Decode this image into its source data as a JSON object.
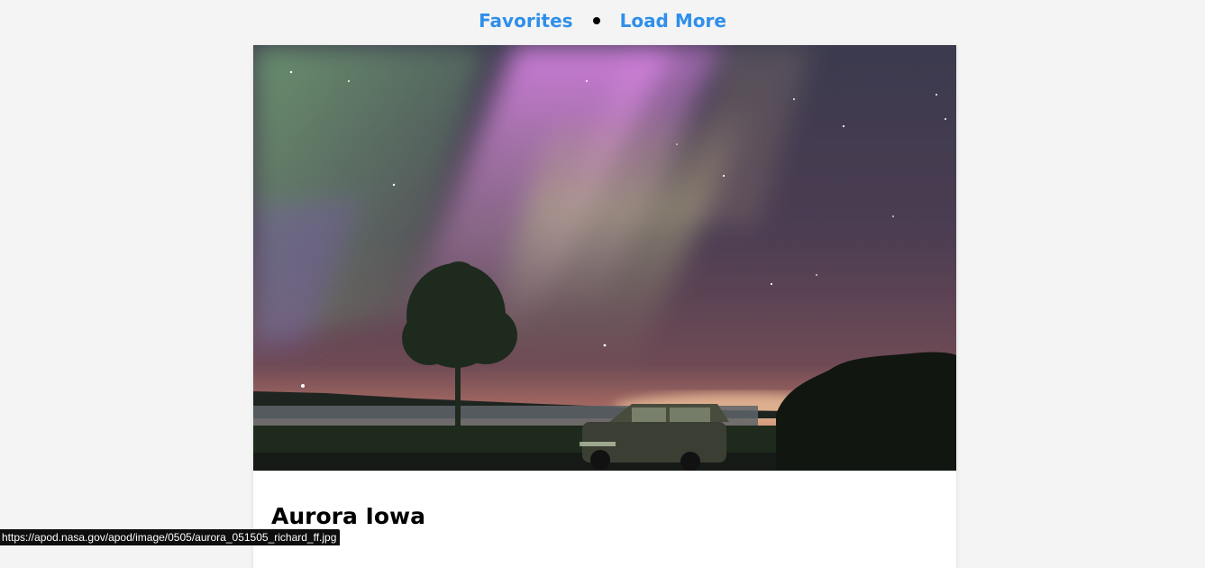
{
  "nav": {
    "favorites_label": "Favorites",
    "load_more_label": "Load More"
  },
  "card": {
    "title": "Aurora Iowa",
    "image_alt": "Aurora over a lake with a tree and parked SUV"
  },
  "status_bar": {
    "url": "https://apod.nasa.gov/apod/image/0505/aurora_051505_richard_ff.jpg"
  },
  "colors": {
    "link": "#2f8fea",
    "background": "#f4f4f4",
    "card": "#ffffff"
  }
}
